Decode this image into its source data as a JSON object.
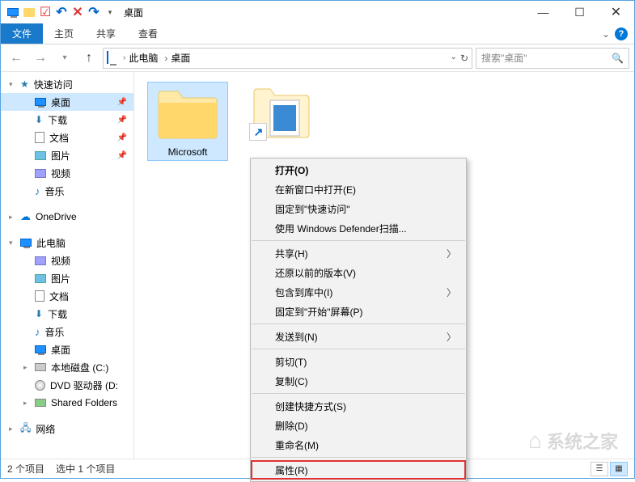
{
  "titlebar": {
    "title": "桌面"
  },
  "window_controls": {
    "min": "—",
    "max": "☐",
    "close": "✕"
  },
  "ribbon": {
    "file": "文件",
    "home": "主页",
    "share": "共享",
    "view": "查看"
  },
  "breadcrumb": {
    "root": "此电脑",
    "current": "桌面"
  },
  "search": {
    "placeholder": "搜索\"桌面\""
  },
  "sidebar": {
    "quick_access": "快速访问",
    "items_qa": [
      {
        "label": "桌面",
        "pin": true
      },
      {
        "label": "下载",
        "pin": true
      },
      {
        "label": "文档",
        "pin": true
      },
      {
        "label": "图片",
        "pin": true
      },
      {
        "label": "视频"
      },
      {
        "label": "音乐"
      }
    ],
    "onedrive": "OneDrive",
    "this_pc": "此电脑",
    "items_pc": [
      {
        "label": "视频"
      },
      {
        "label": "图片"
      },
      {
        "label": "文档"
      },
      {
        "label": "下载"
      },
      {
        "label": "音乐"
      },
      {
        "label": "桌面"
      },
      {
        "label": "本地磁盘 (C:)"
      },
      {
        "label": "DVD 驱动器 (D:"
      },
      {
        "label": "Shared Folders"
      }
    ],
    "network": "网络"
  },
  "content": {
    "items": [
      {
        "label": "Microsoft"
      },
      {
        "label": ""
      }
    ]
  },
  "context_menu": {
    "open": "打开(O)",
    "open_new_window": "在新窗口中打开(E)",
    "pin_quick_access": "固定到\"快速访问\"",
    "defender_scan": "使用 Windows Defender扫描...",
    "share": "共享(H)",
    "restore_versions": "还原以前的版本(V)",
    "include_library": "包含到库中(I)",
    "pin_start": "固定到\"开始\"屏幕(P)",
    "send_to": "发送到(N)",
    "cut": "剪切(T)",
    "copy": "复制(C)",
    "create_shortcut": "创建快捷方式(S)",
    "delete": "删除(D)",
    "rename": "重命名(M)",
    "properties": "属性(R)"
  },
  "statusbar": {
    "count": "2 个项目",
    "selected": "选中 1 个项目"
  },
  "watermark": "系统之家"
}
